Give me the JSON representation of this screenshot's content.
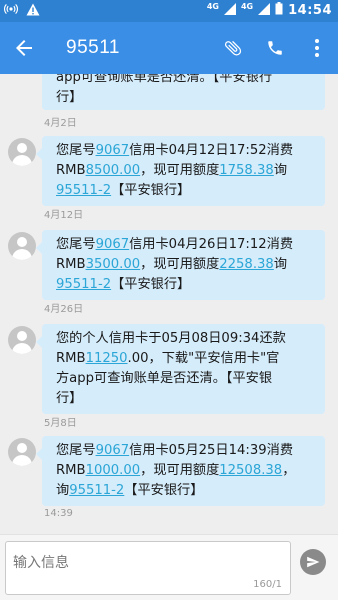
{
  "status_bar": {
    "network_1": "4G",
    "network_2": "4G",
    "time": "14:54"
  },
  "app_bar": {
    "title": "95511",
    "icons": [
      "back-arrow-icon",
      "attachment-icon",
      "phone-icon",
      "more-vert-icon"
    ]
  },
  "messages": [
    {
      "text_lines": [
        "app可查询账单是否还清。【平安银行",
        "行】"
      ],
      "timestamp": "4月2日"
    },
    {
      "text": "您尾号9067信用卡04月12日17:52消费RMB8500.00，现可用额度1758.38询95511-2【平安银行】",
      "parts": [
        "您尾号",
        "9067",
        "信用卡04月12日17:52消费",
        "RMB",
        "8500.00",
        "，现可用额度",
        "1758.38",
        "询",
        "95511-2",
        "【平安银行】"
      ],
      "timestamp": "4月12日"
    },
    {
      "text": "您尾号9067信用卡04月26日17:12消费RMB3500.00，现可用额度2258.38询95511-2【平安银行】",
      "parts": [
        "您尾号",
        "9067",
        "信用卡04月26日17:12消费",
        "RMB",
        "3500.00",
        "，现可用额度",
        "2258.38",
        "询",
        "95511-2",
        "【平安银行】"
      ],
      "timestamp": "4月26日"
    },
    {
      "text": "您的个人信用卡于05月08日09:34还款RMB11250.00，下载\"平安信用卡\"官方app可查询账单是否还清。【平安银行】",
      "parts": [
        "您的个人信用卡于05月08日09:34还款",
        "RMB",
        "11250",
        ".00，下载\"平安信用卡\"官",
        "方app可查询账单是否还清。【平安银",
        "行】"
      ],
      "timestamp": "5月8日"
    },
    {
      "text": "您尾号9067信用卡05月25日14:39消费RMB1000.00，现可用额度12508.38，询95511-2【平安银行】",
      "parts": [
        "您尾号",
        "9067",
        "信用卡05月25日14:39消费",
        "RMB",
        "1000.00",
        "，现可用额度",
        "12508.38",
        "，",
        "询",
        "95511-2",
        "【平安银行】"
      ],
      "timestamp": "14:39"
    }
  ],
  "composer": {
    "placeholder": "输入信息",
    "counter": "160/1"
  },
  "colors": {
    "status_bar": "#2e80d0",
    "app_bar": "#3a8ee6",
    "bubble": "#d5ecfb",
    "link": "#2ba6d6",
    "background": "#eeeeee"
  }
}
